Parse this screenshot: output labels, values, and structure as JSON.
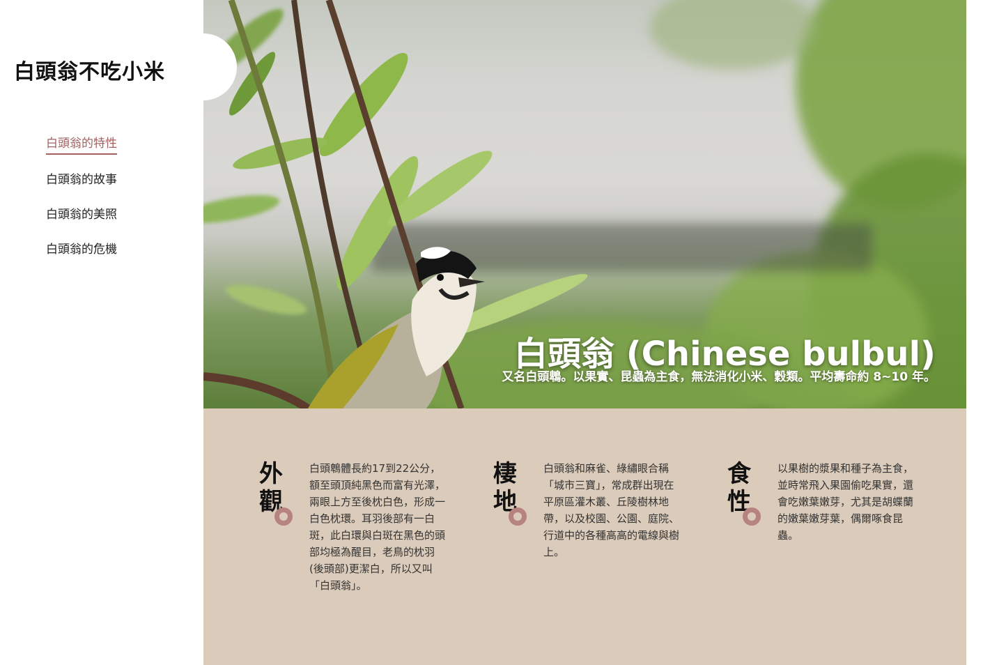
{
  "site": {
    "title": "白頭翁不吃小米"
  },
  "nav": {
    "items": [
      {
        "label": "白頭翁的特性",
        "active": true
      },
      {
        "label": "白頭翁的故事",
        "active": false
      },
      {
        "label": "白頭翁的美照",
        "active": false
      },
      {
        "label": "白頭翁的危機",
        "active": false
      }
    ]
  },
  "hero": {
    "title": "白頭翁 (Chinese bulbul)",
    "subtitle": "又名白頭鵯。以果實、昆蟲為主食，無法消化小米、穀類。平均壽命約 8~10 年。"
  },
  "cards": [
    {
      "heading": "外觀",
      "text": "白頭鵯體長約17到22公分，額至頭頂純黑色而富有光澤，兩眼上方至後枕白色，形成一白色枕環。耳羽後部有一白斑，此白環與白斑在黑色的頭部均極為醒目，老鳥的枕羽(後頭部)更潔白，所以又叫「白頭翁」。"
    },
    {
      "heading": "棲地",
      "text": "白頭翁和麻雀、綠繡眼合稱「城市三寶」，常成群出現在平原區灌木叢、丘陵樹林地帶，以及校園、公園、庭院、行道中的各種高高的電線與樹上。"
    },
    {
      "heading": "食性",
      "text": "以果樹的漿果和種子為主食，並時常飛入果園偷吃果實，還會吃嫩葉嫩芽，尤其是胡蝶蘭的嫩葉嫩芽葉，偶爾啄食昆蟲。"
    }
  ],
  "colors": {
    "accent": "#a3605f",
    "info_bg": "#dbcbba",
    "ring": "#b7837f"
  }
}
